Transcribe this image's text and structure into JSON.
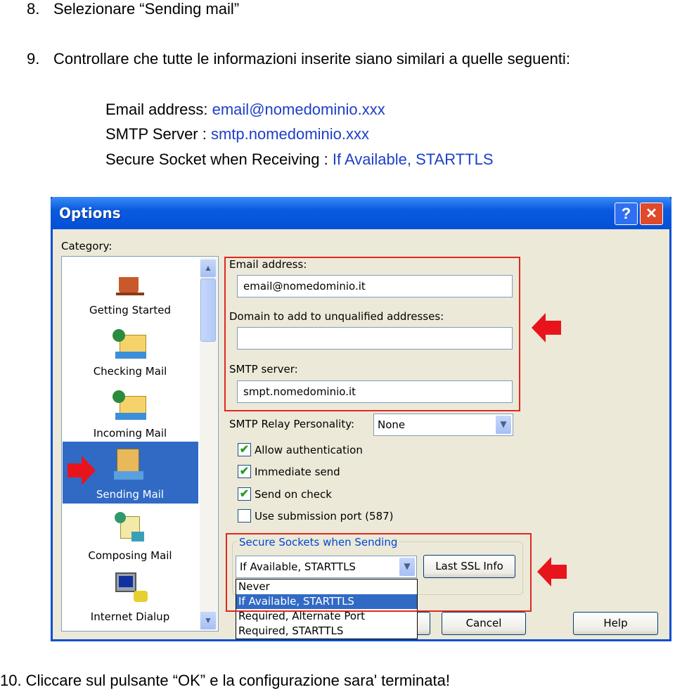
{
  "steps": [
    {
      "num": "8.",
      "text": "Selezionare “Sending mail”"
    },
    {
      "num": "9.",
      "text": "Controllare che tutte le informazioni inserite siano similari a quelle seguenti:"
    },
    {
      "num": "10.",
      "text": "Cliccare sul pulsante “OK” e la configurazione sara' terminata!"
    }
  ],
  "expected": [
    {
      "label": "Email address: ",
      "value": "email@nomedominio.xxx"
    },
    {
      "label": "SMTP Server : ",
      "value": "smtp.nomedominio.xxx"
    },
    {
      "label": "Secure Socket when Receiving : ",
      "value": "If Available, STARTTLS"
    }
  ],
  "dialog": {
    "title": "Options",
    "help_label": "?",
    "close_label": "✕",
    "category_label": "Category:",
    "categories": [
      {
        "label": "Getting Started",
        "icon": "coffee-cup-icon"
      },
      {
        "label": "Checking Mail",
        "icon": "mail-download-icon"
      },
      {
        "label": "Incoming Mail",
        "icon": "mail-download-icon"
      },
      {
        "label": "Sending Mail",
        "icon": "mail-send-icon",
        "selected": true
      },
      {
        "label": "Composing Mail",
        "icon": "compose-icon"
      },
      {
        "label": "Internet Dialup",
        "icon": "computer-phone-icon"
      }
    ],
    "email_label": "Email address:",
    "email_value": "email@nomedominio.it",
    "domain_label": "Domain to add to unqualified addresses:",
    "domain_value": "",
    "smtp_label": "SMTP server:",
    "smtp_value": "smpt.nomedominio.it",
    "relay_label": "SMTP Relay Personality:",
    "relay_value": "None",
    "checkboxes": [
      {
        "label": "Allow authentication",
        "checked": true
      },
      {
        "label": "Immediate send",
        "checked": true
      },
      {
        "label": "Send on check",
        "checked": true
      },
      {
        "label": "Use submission port (587)",
        "checked": false
      }
    ],
    "ssl_group_label": "Secure Sockets when Sending",
    "ssl_value": "If Available, STARTTLS",
    "ssl_options": [
      "Never",
      "If Available, STARTTLS",
      "Required, Alternate Port",
      "Required, STARTTLS"
    ],
    "ssl_highlighted": "If Available, STARTTLS",
    "last_ssl_label": "Last SSL Info",
    "cancel_label": "Cancel",
    "help_button_label": "Help",
    "check_mark": "✔",
    "dropdown_glyph": "⌄"
  },
  "colors": {
    "annotation_red": "#e0281f",
    "value_blue": "#1d3fc8",
    "selection_blue": "#316ac5"
  }
}
